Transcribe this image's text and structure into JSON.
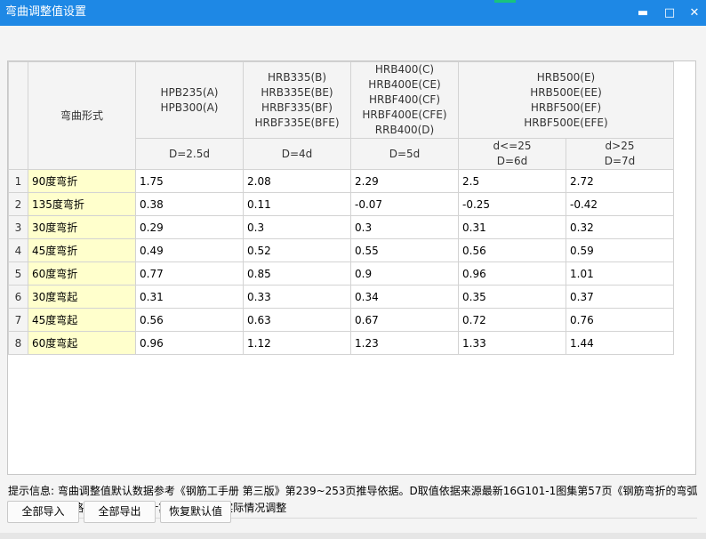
{
  "window": {
    "title": "弯曲调整值设置",
    "minimize_glyph": "▬",
    "maximize_glyph": "□",
    "close_glyph": "✕",
    "accent_color": "#1e88e5"
  },
  "table": {
    "shape_header": "弯曲形式",
    "groups": [
      {
        "lines": [
          "HPB235(A)",
          "HPB300(A)"
        ],
        "d_value": "D=2.5d"
      },
      {
        "lines": [
          "HRB335(B)",
          "HRB335E(BE)",
          "HRBF335(BF)",
          "HRBF335E(BFE)"
        ],
        "d_value": "D=4d"
      },
      {
        "lines": [
          "HRB400(C)",
          "HRB400E(CE)",
          "HRBF400(CF)",
          "HRBF400E(CFE)",
          "RRB400(D)"
        ],
        "d_value": "D=5d"
      },
      {
        "lines": [
          "HRB500(E)",
          "HRB500E(EE)",
          "HRBF500(EF)",
          "HRBF500E(EFE)"
        ],
        "d_values": [
          [
            "d<=25",
            "D=6d"
          ],
          [
            "d>25",
            "D=7d"
          ]
        ]
      }
    ],
    "rows": [
      {
        "num": "1",
        "shape": "90度弯折",
        "values": [
          "1.75",
          "2.08",
          "2.29",
          "2.5",
          "2.72"
        ]
      },
      {
        "num": "2",
        "shape": "135度弯折",
        "values": [
          "0.38",
          "0.11",
          "-0.07",
          "-0.25",
          "-0.42"
        ]
      },
      {
        "num": "3",
        "shape": "30度弯折",
        "values": [
          "0.29",
          "0.3",
          "0.3",
          "0.31",
          "0.32"
        ]
      },
      {
        "num": "4",
        "shape": "45度弯折",
        "values": [
          "0.49",
          "0.52",
          "0.55",
          "0.56",
          "0.59"
        ]
      },
      {
        "num": "5",
        "shape": "60度弯折",
        "values": [
          "0.77",
          "0.85",
          "0.9",
          "0.96",
          "1.01"
        ]
      },
      {
        "num": "6",
        "shape": "30度弯起",
        "values": [
          "0.31",
          "0.33",
          "0.34",
          "0.35",
          "0.37"
        ]
      },
      {
        "num": "7",
        "shape": "45度弯起",
        "values": [
          "0.56",
          "0.63",
          "0.67",
          "0.72",
          "0.76"
        ]
      },
      {
        "num": "8",
        "shape": "60度弯起",
        "values": [
          "0.96",
          "1.12",
          "1.23",
          "1.33",
          "1.44"
        ]
      }
    ]
  },
  "hint": {
    "line1": "提示信息: 弯曲调整值默认数据参考《钢筋工手册 第三版》第239~253页推导依据。D取值依据来源最新16G101-1图集第57页《钢筋弯折的弯弧",
    "line2": "内直径D》;表格内数据为理论计算值，可根据实际情况调整"
  },
  "buttons": {
    "import_all": "全部导入",
    "export_all": "全部导出",
    "restore_default": "恢复默认值"
  }
}
